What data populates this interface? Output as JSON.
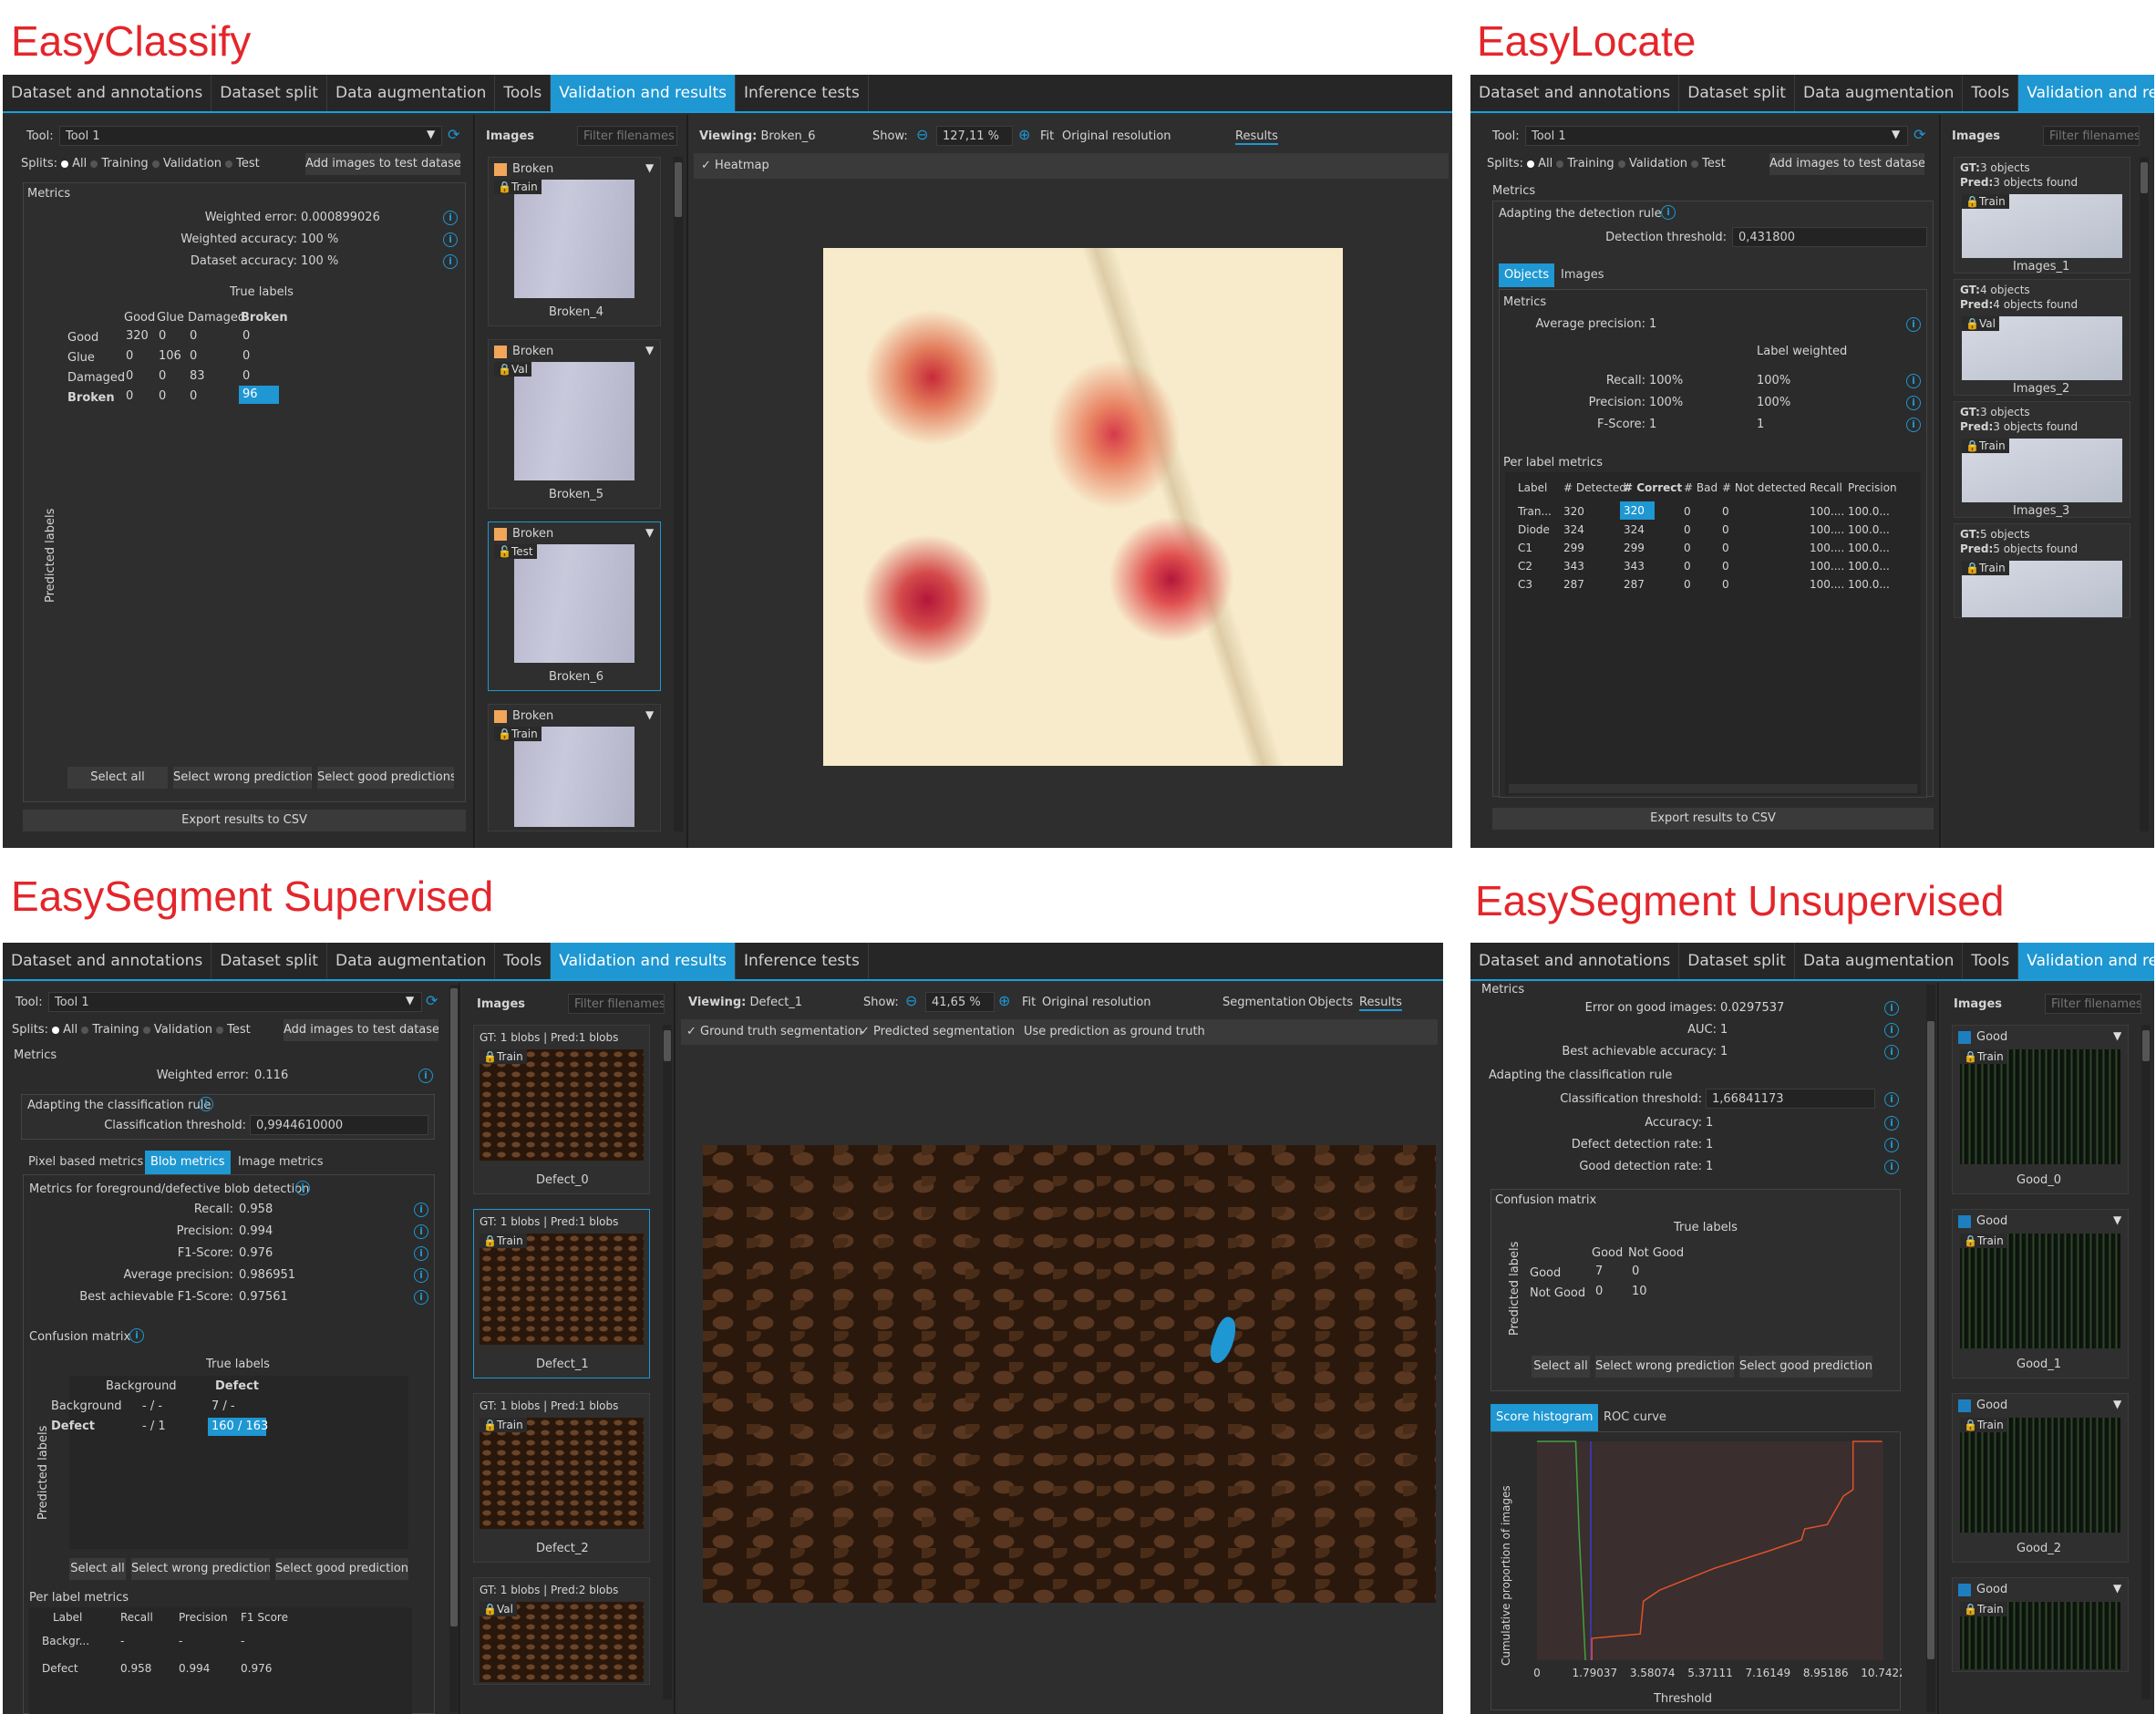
{
  "titles": {
    "classify": "EasyClassify",
    "locate": "EasyLocate",
    "seg_sup": "EasySegment Supervised",
    "seg_unsup": "EasySegment Unsupervised"
  },
  "tabs": [
    "Dataset and annotations",
    "Dataset split",
    "Data augmentation",
    "Tools",
    "Validation and results",
    "Inference tests"
  ],
  "colors": {
    "accent": "#1e97d2",
    "title_red": "#e3262b",
    "broken_chip": "#f2a65a",
    "good_chip": "#1e7fc0"
  },
  "common": {
    "tool_label": "Tool:",
    "tool_value": "Tool 1",
    "splits_label": "Splits:",
    "split_all": "All",
    "split_training": "Training",
    "split_validation": "Validation",
    "split_test": "Test",
    "add_images": "Add images to test dataset",
    "metrics": "Metrics",
    "images": "Images",
    "filter_placeholder": "Filter filenames",
    "select_all": "Select all",
    "select_wrong": "Select wrong predictions",
    "select_good": "Select good predictions",
    "export_csv": "Export results to CSV",
    "true_labels": "True labels",
    "predicted_labels": "Predicted labels",
    "show": "Show:",
    "fit": "Fit",
    "original_resolution": "Original resolution",
    "results": "Results",
    "viewing": "Viewing:"
  },
  "classify": {
    "weighted_error_label": "Weighted error:",
    "weighted_error": "0.000899026",
    "weighted_accuracy_label": "Weighted accuracy:",
    "weighted_accuracy": "100 %",
    "dataset_accuracy_label": "Dataset accuracy:",
    "dataset_accuracy": "100 %",
    "col_headers": [
      "Good",
      "Glue",
      "Damaged",
      "Broken"
    ],
    "rows": [
      {
        "label": "Good",
        "values": [
          "320",
          "0",
          "0",
          "0"
        ]
      },
      {
        "label": "Glue",
        "values": [
          "0",
          "106",
          "0",
          "0"
        ]
      },
      {
        "label": "Damaged",
        "values": [
          "0",
          "0",
          "83",
          "0"
        ]
      },
      {
        "label": "Broken",
        "values": [
          "0",
          "0",
          "0",
          "96"
        ]
      }
    ],
    "viewing": "Broken_6",
    "zoom": "127,11 %",
    "heatmap": "Heatmap",
    "thumbs": [
      {
        "label": "Broken",
        "split": "Train",
        "name": "Broken_4"
      },
      {
        "label": "Broken",
        "split": "Val",
        "name": "Broken_5"
      },
      {
        "label": "Broken",
        "split": "Test",
        "name": "Broken_6"
      },
      {
        "label": "Broken",
        "split": "Train",
        "name": ""
      }
    ]
  },
  "locate": {
    "adapting": "Adapting the detection rule",
    "threshold_label": "Detection threshold:",
    "threshold": "0,431800",
    "tab_objects": "Objects",
    "tab_images": "Images",
    "avg_precision_label": "Average precision:",
    "avg_precision": "1",
    "label_weighted": "Label weighted",
    "recall_label": "Recall:",
    "recall": "100%",
    "recall_w": "100%",
    "precision_label": "Precision:",
    "precision": "100%",
    "precision_w": "100%",
    "fscore_label": "F-Score:",
    "fscore": "1",
    "fscore_w": "1",
    "per_label": "Per label metrics",
    "table_headers": [
      "Label",
      "# Detected",
      "# Correct",
      "# Bad",
      "# Not detected",
      "Recall",
      "Precision"
    ],
    "table_rows": [
      [
        "Tran...",
        "320",
        "320",
        "0",
        "0",
        "100....",
        "100.0..."
      ],
      [
        "Diode",
        "324",
        "324",
        "0",
        "0",
        "100....",
        "100.0..."
      ],
      [
        "C1",
        "299",
        "299",
        "0",
        "0",
        "100....",
        "100.0..."
      ],
      [
        "C2",
        "343",
        "343",
        "0",
        "0",
        "100....",
        "100.0..."
      ],
      [
        "C3",
        "287",
        "287",
        "0",
        "0",
        "100....",
        "100.0..."
      ]
    ],
    "thumbs": [
      {
        "gt": "3 objects",
        "pred": "3 objects found",
        "split": "Train",
        "name": "Images_1"
      },
      {
        "gt": "4 objects",
        "pred": "4 objects found",
        "split": "Val",
        "name": "Images_2"
      },
      {
        "gt": "3 objects",
        "pred": "3 objects found",
        "split": "Train",
        "name": "Images_3"
      },
      {
        "gt": "5 objects",
        "pred": "5 objects found",
        "split": "Train",
        "name": ""
      }
    ],
    "gt_label": "GT:",
    "pred_label": "Pred:"
  },
  "seg_sup": {
    "weighted_error_label": "Weighted error:",
    "weighted_error": "0.116",
    "adapting": "Adapting the classification rule",
    "threshold_label": "Classification threshold:",
    "threshold": "0,9944610000",
    "tab_pixel": "Pixel based metrics",
    "tab_blob": "Blob metrics",
    "tab_image": "Image metrics",
    "blob_title": "Metrics for foreground/defective blob detection",
    "metrics": [
      {
        "label": "Recall:",
        "value": "0.958"
      },
      {
        "label": "Precision:",
        "value": "0.994"
      },
      {
        "label": "F1-Score:",
        "value": "0.976"
      },
      {
        "label": "Average precision:",
        "value": "0.986951"
      },
      {
        "label": "Best achievable F1-Score:",
        "value": "0.97561"
      }
    ],
    "confusion": "Confusion matrix",
    "col_headers": [
      "Background",
      "Defect"
    ],
    "rows": [
      {
        "label": "Background",
        "values": [
          "- / -",
          "7 / -"
        ]
      },
      {
        "label": "Defect",
        "values": [
          "- / 1",
          "160 / 163"
        ]
      }
    ],
    "per_label": "Per label metrics",
    "pl_headers": [
      "Label",
      "Recall",
      "Precision",
      "F1 Score"
    ],
    "pl_rows": [
      [
        "Backgr...",
        "-",
        "-",
        "-"
      ],
      [
        "Defect",
        "0.958",
        "0.994",
        "0.976"
      ]
    ],
    "viewing": "Defect_1",
    "zoom": "41,65 %",
    "tab_segmentation": "Segmentation",
    "tab_objects": "Objects",
    "gt_seg": "Ground truth segmentation",
    "pred_seg": "Predicted segmentation",
    "use_pred": "Use prediction as ground truth",
    "thumbs": [
      {
        "caption": "GT: 1 blobs | Pred:1 blobs",
        "split": "Train",
        "name": "Defect_0"
      },
      {
        "caption": "GT: 1 blobs | Pred:1 blobs",
        "split": "Train",
        "name": "Defect_1"
      },
      {
        "caption": "GT: 1 blobs | Pred:1 blobs",
        "split": "Train",
        "name": "Defect_2"
      },
      {
        "caption": "GT: 1 blobs | Pred:2 blobs",
        "split": "Val",
        "name": ""
      }
    ]
  },
  "seg_unsup": {
    "error_good_label": "Error on good images:",
    "error_good": "0.0297537",
    "auc_label": "AUC:",
    "auc": "1",
    "best_acc_label": "Best achievable accuracy:",
    "best_acc": "1",
    "adapting": "Adapting the classification rule",
    "threshold_label": "Classification threshold:",
    "threshold": "1,66841173",
    "accuracy_label": "Accuracy:",
    "accuracy": "1",
    "ddr_label": "Defect detection rate:",
    "ddr": "1",
    "gdr_label": "Good detection rate:",
    "gdr": "1",
    "confusion": "Confusion matrix",
    "col_headers": [
      "Good",
      "Not Good"
    ],
    "rows": [
      {
        "label": "Good",
        "values": [
          "7",
          "0"
        ]
      },
      {
        "label": "Not Good",
        "values": [
          "0",
          "10"
        ]
      }
    ],
    "tab_hist": "Score histogram",
    "tab_roc": "ROC curve",
    "chart_ylabel": "Cumulative proportion of images",
    "chart_xlabel": "Threshold",
    "thumbs": [
      {
        "label": "Good",
        "split": "Train",
        "name": "Good_0"
      },
      {
        "label": "Good",
        "split": "Train",
        "name": "Good_1"
      },
      {
        "label": "Good",
        "split": "Train",
        "name": "Good_2"
      },
      {
        "label": "Good",
        "split": "Train",
        "name": ""
      }
    ]
  },
  "chart_data": {
    "type": "line",
    "title": "",
    "xlabel": "Threshold",
    "ylabel": "Cumulative proportion of images",
    "x_ticks": [
      "0",
      "1.79037",
      "3.58074",
      "5.37111",
      "7.16149",
      "8.95186",
      "10.7422"
    ],
    "xlim": [
      0,
      10.7422
    ],
    "ylim": [
      0,
      1
    ],
    "series": [
      {
        "color": "#3fa33f",
        "x": [
          0,
          0.3,
          1.2,
          1.3,
          1.35,
          1.4,
          1.5
        ],
        "y": [
          1,
          1,
          1,
          0.6,
          0.45,
          0.3,
          0
        ]
      },
      {
        "color": "#3a3ad0",
        "x": [
          1.668,
          1.668
        ],
        "y": [
          0,
          1
        ]
      },
      {
        "color": "#e0522a",
        "x": [
          1.7,
          1.7,
          3.2,
          3.3,
          3.8,
          5.5,
          7.2,
          8.2,
          8.3,
          9.0,
          9.5,
          9.8,
          9.8,
          10.7
        ],
        "y": [
          0,
          0.1,
          0.12,
          0.27,
          0.32,
          0.42,
          0.5,
          0.55,
          0.6,
          0.62,
          0.75,
          0.78,
          1,
          1
        ]
      }
    ]
  }
}
